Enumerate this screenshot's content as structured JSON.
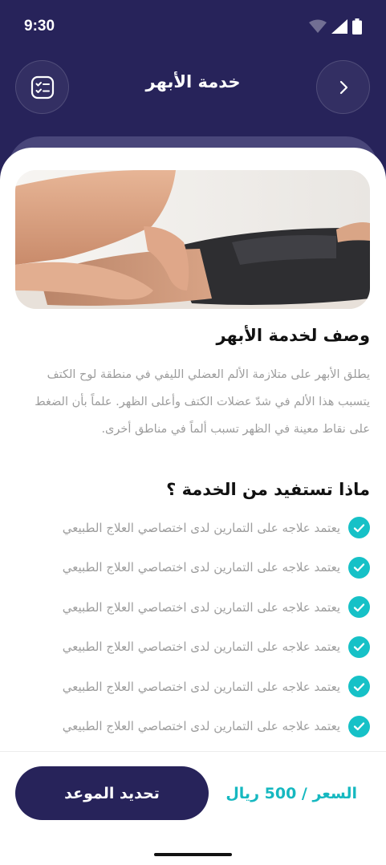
{
  "status_bar": {
    "time": "9:30",
    "icons": [
      "wifi-icon",
      "signal-icon",
      "battery-icon"
    ]
  },
  "header": {
    "title": "خدمة الأبهر",
    "left_icon": "checklist-icon",
    "right_icon": "chevron-right-icon"
  },
  "hero_image": {
    "alt": "massage-photo"
  },
  "description": {
    "title": "وصف لخدمة الأبهر",
    "body": "يطلق الأبهر على متلازمة الألم العضلي الليفي في منطقة لوح الكتف يتسبب هذا الألم في شدّ عضلات الكتف وأعلى الظهر. علماً بأن الضغط على نقاط معينة في الظهر تسبب ألماً في مناطق أخرى."
  },
  "benefits": {
    "title": "ماذا تستفيد من الخدمة ؟",
    "items": [
      "يعتمد علاجه على التمارين لدى اختصاصي العلاج الطبيعي",
      "يعتمد علاجه على التمارين لدى اختصاصي العلاج الطبيعي",
      "يعتمد علاجه على التمارين لدى اختصاصي العلاج الطبيعي",
      "يعتمد علاجه على التمارين لدى اختصاصي العلاج الطبيعي",
      "يعتمد علاجه على التمارين لدى اختصاصي العلاج الطبيعي",
      "يعتمد علاجه على التمارين لدى اختصاصي العلاج الطبيعي"
    ]
  },
  "footer": {
    "price": "السعر / 500 ريال",
    "book_label": "تحديد الموعد"
  },
  "colors": {
    "primary": "#27235a",
    "accent": "#16c1c7",
    "muted_text": "#9d9d9d"
  }
}
